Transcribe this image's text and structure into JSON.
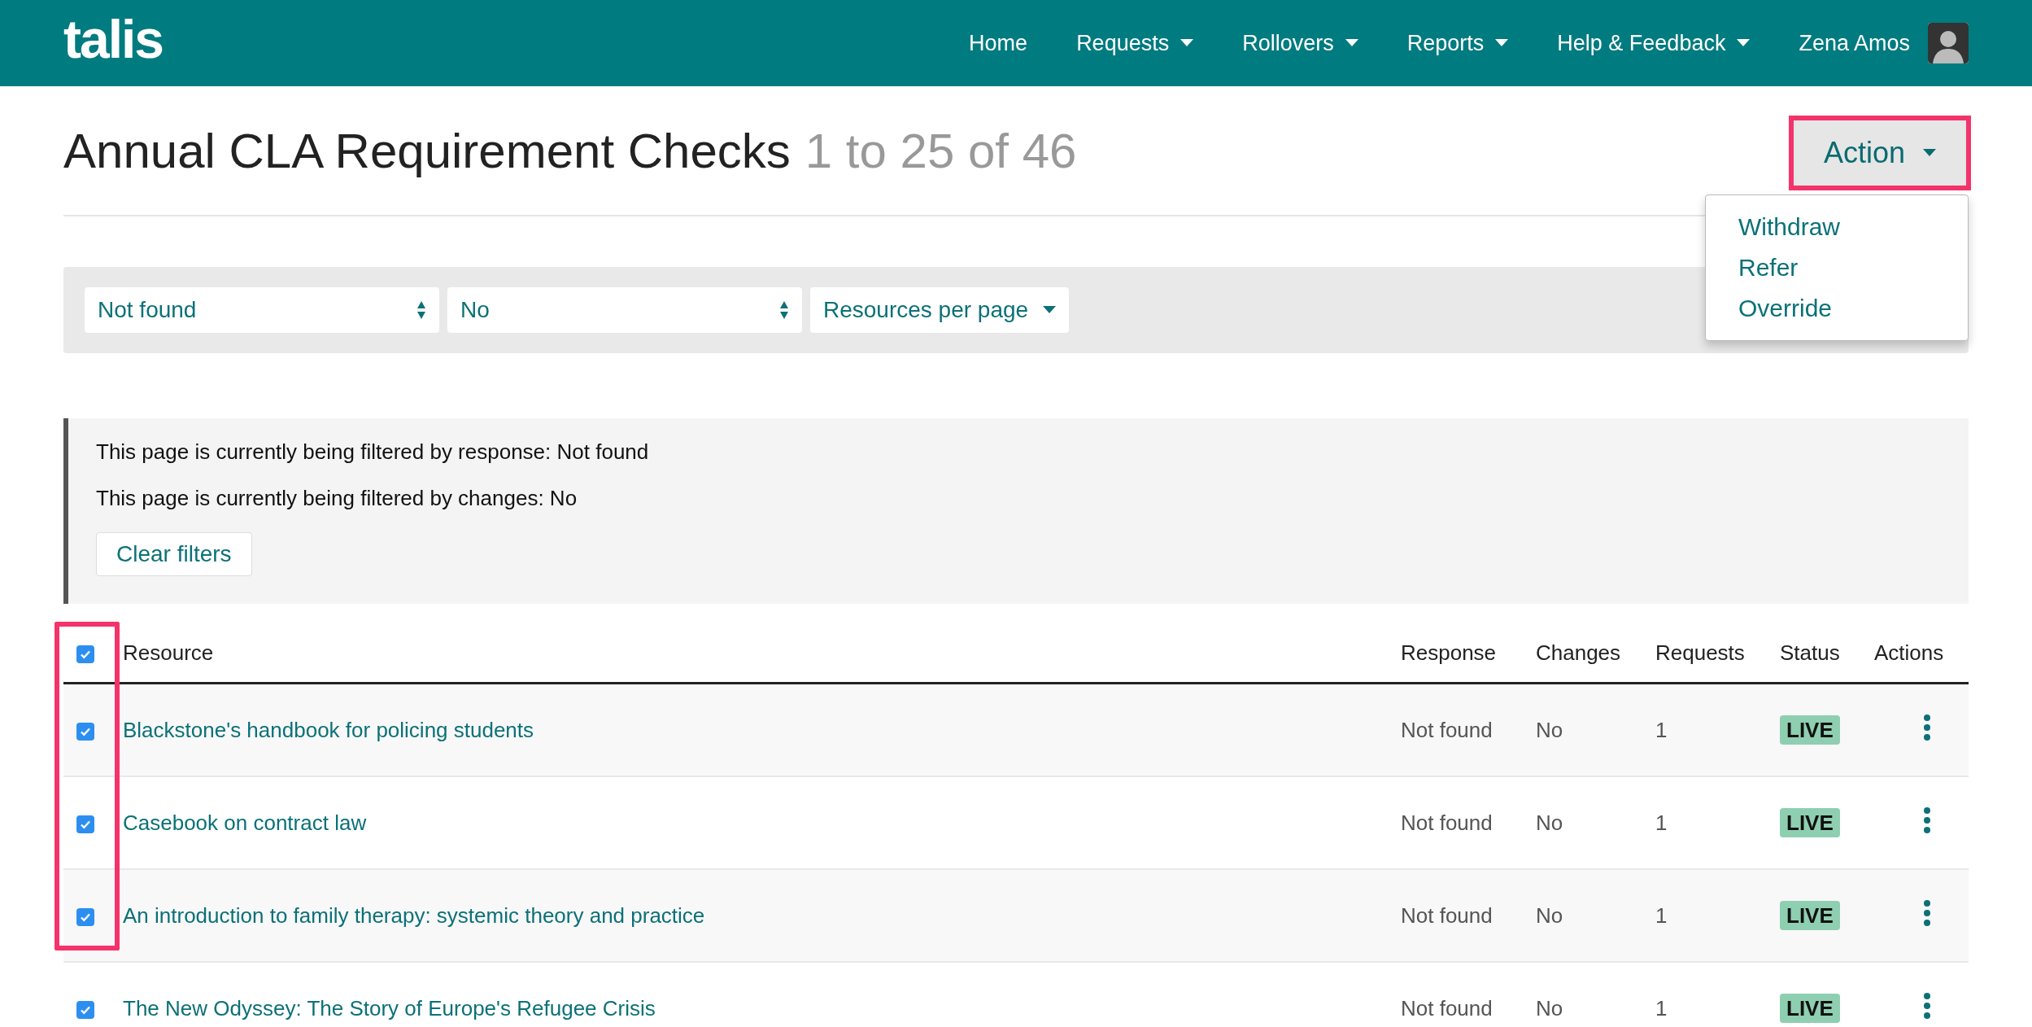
{
  "header": {
    "logo": "talis",
    "nav": [
      {
        "label": "Home",
        "dropdown": false
      },
      {
        "label": "Requests",
        "dropdown": true
      },
      {
        "label": "Rollovers",
        "dropdown": true
      },
      {
        "label": "Reports",
        "dropdown": true
      },
      {
        "label": "Help & Feedback",
        "dropdown": true
      }
    ],
    "user": {
      "name": "Zena Amos"
    }
  },
  "title": {
    "text": "Annual CLA Requirement Checks",
    "count": "1 to 25 of 46"
  },
  "action": {
    "label": "Action",
    "highlighted": true,
    "expanded": true,
    "menu": [
      "Withdraw",
      "Refer",
      "Override"
    ]
  },
  "filters": {
    "response": {
      "value": "Not found"
    },
    "changes": {
      "value": "No"
    },
    "per_page": {
      "label": "Resources per page"
    }
  },
  "notice": {
    "lines": [
      "This page is currently being filtered by response: Not found",
      "This page is currently being filtered by changes: No"
    ],
    "clear_button": "Clear filters"
  },
  "table": {
    "select_all_checked": true,
    "checkbox_column_highlighted": true,
    "columns": [
      "Resource",
      "Response",
      "Changes",
      "Requests",
      "Status",
      "Actions"
    ],
    "rows": [
      {
        "checked": true,
        "resource": "Blackstone's handbook for policing students",
        "response": "Not found",
        "changes": "No",
        "requests": "1",
        "status": "LIVE"
      },
      {
        "checked": true,
        "resource": "Casebook on contract law",
        "response": "Not found",
        "changes": "No",
        "requests": "1",
        "status": "LIVE"
      },
      {
        "checked": true,
        "resource": "An introduction to family therapy: systemic theory and practice",
        "response": "Not found",
        "changes": "No",
        "requests": "1",
        "status": "LIVE"
      },
      {
        "checked": true,
        "resource": "The New Odyssey: The Story of Europe's Refugee Crisis",
        "response": "Not found",
        "changes": "No",
        "requests": "1",
        "status": "LIVE"
      }
    ]
  }
}
